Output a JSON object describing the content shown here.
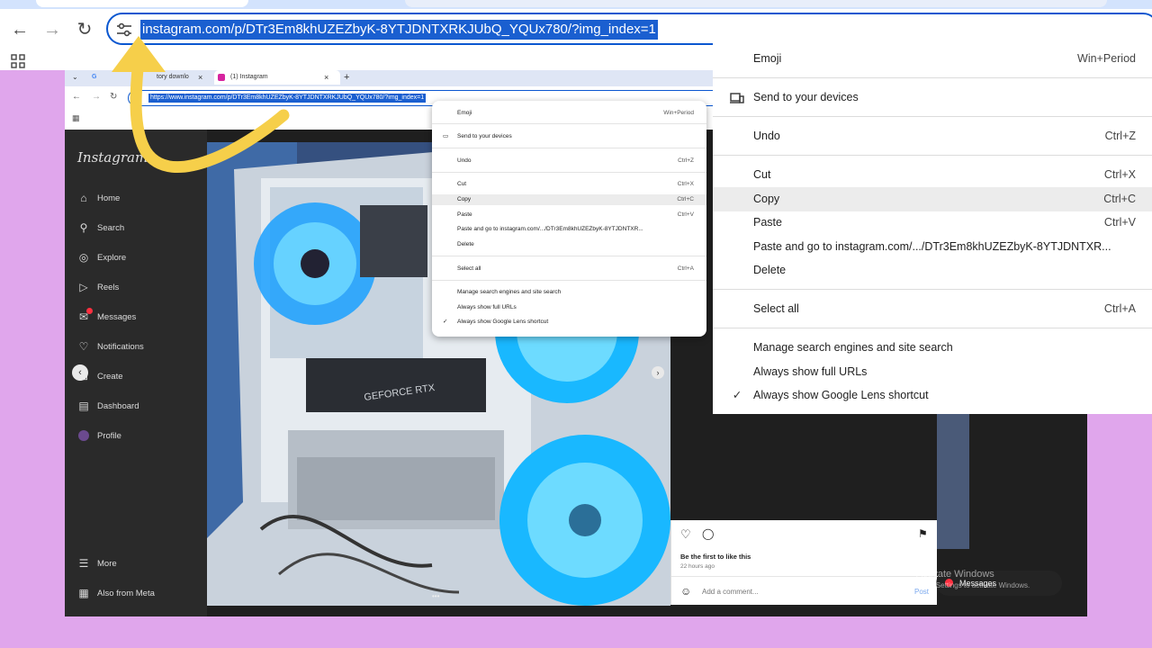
{
  "browser": {
    "url": "instagram.com/p/DTr3Em8khUZEZbyK-8YTJDNTXRKJUbQ_YQUx780/?img_index=1",
    "icons": [
      "back-arrow-icon",
      "forward-arrow-icon",
      "reload-icon",
      "tune-icon",
      "apps-grid-icon"
    ]
  },
  "inner_browser": {
    "tabs": [
      {
        "label": "tory downlo"
      },
      {
        "label": "(1) Instagram"
      }
    ],
    "url": "https://www.instagram.com/p/DTr3Em8khUZEZbyK-8YTJDNTXRKJUbQ_YQUx780/?img_index=1"
  },
  "instagram": {
    "logo": "Instagram",
    "nav": [
      {
        "label": "Home",
        "icon": "home-icon"
      },
      {
        "label": "Search",
        "icon": "search-icon"
      },
      {
        "label": "Explore",
        "icon": "compass-icon"
      },
      {
        "label": "Reels",
        "icon": "reels-icon"
      },
      {
        "label": "Messages",
        "icon": "messenger-icon"
      },
      {
        "label": "Notifications",
        "icon": "heart-icon"
      },
      {
        "label": "Create",
        "icon": "plus-icon"
      },
      {
        "label": "Dashboard",
        "icon": "dashboard-icon"
      },
      {
        "label": "Profile",
        "icon": "avatar-icon"
      }
    ],
    "footer_nav": [
      {
        "label": "More",
        "icon": "menu-icon"
      },
      {
        "label": "Also from Meta",
        "icon": "meta-icon"
      }
    ],
    "post": {
      "likes_text": "Be the first to like this",
      "time_ago": "22 hours ago",
      "comment_placeholder": "Add a comment...",
      "post_label": "Post"
    },
    "messages_pill": "Messages"
  },
  "context_menu": {
    "items": [
      {
        "label": "Emoji",
        "shortcut": "Win+Period"
      },
      {
        "label": "Send to your devices",
        "shortcut": ""
      },
      {
        "label": "Undo",
        "shortcut": "Ctrl+Z"
      },
      {
        "label": "Cut",
        "shortcut": "Ctrl+X"
      },
      {
        "label": "Copy",
        "shortcut": "Ctrl+C"
      },
      {
        "label": "Paste",
        "shortcut": "Ctrl+V"
      },
      {
        "label": "Paste and go to instagram.com/.../DTr3Em8khUZEZbyK-8YTJDNTXR...",
        "shortcut": ""
      },
      {
        "label": "Delete",
        "shortcut": ""
      },
      {
        "label": "Select all",
        "shortcut": "Ctrl+A"
      },
      {
        "label": "Manage search engines and site search",
        "shortcut": ""
      },
      {
        "label": "Always show full URLs",
        "shortcut": ""
      },
      {
        "label": "Always show Google Lens shortcut",
        "shortcut": ""
      }
    ],
    "highlighted": "Copy",
    "checked": "Always show Google Lens shortcut"
  },
  "watermark": {
    "title": "Activate Windows",
    "subtitle": "Go to Settings to activate Windows."
  },
  "colors": {
    "background": "#e0a6ec",
    "accent": "#0b57d0",
    "selection": "#1a5fd0",
    "arrow": "#f6cf4a"
  }
}
